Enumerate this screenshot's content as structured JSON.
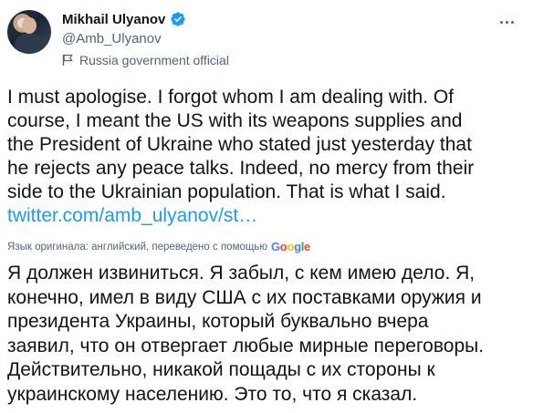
{
  "author": {
    "name": "Mikhail Ulyanov",
    "handle": "@Amb_Ulyanov",
    "label": "Russia government official"
  },
  "tweet": {
    "text_lines": "I must apologise. I forgot whom I am dealing with. Of\ncourse, I meant the US with its weapons supplies and\nthe President of Ukraine who stated just yesterday that\nhe rejects any peace talks. Indeed, no mercy from their\nside to the Ukrainian population. That is what I said.",
    "link": "twitter.com/amb_ulyanov/st…"
  },
  "translation": {
    "note": "Язык оригинала: английский, переведено с помощью",
    "provider": "Google",
    "text": "Я должен извиниться. Я забыл, с кем имею дело. Я,\nконечно, имел в виду США с их поставками оружия и\nпрезидента Украины, который буквально вчера\nзаявил, что он отвергает любые мирные переговоры.\nДействительно, никакой пощады с их стороны к\nукраинскому населению. Это то, что я сказал."
  },
  "colors": {
    "link": "#1d9bf0",
    "secondary_text": "#536471",
    "verified": "#1d9bf0"
  },
  "icons": [
    "verified-badge-icon",
    "flag-icon",
    "more-options-icon"
  ]
}
